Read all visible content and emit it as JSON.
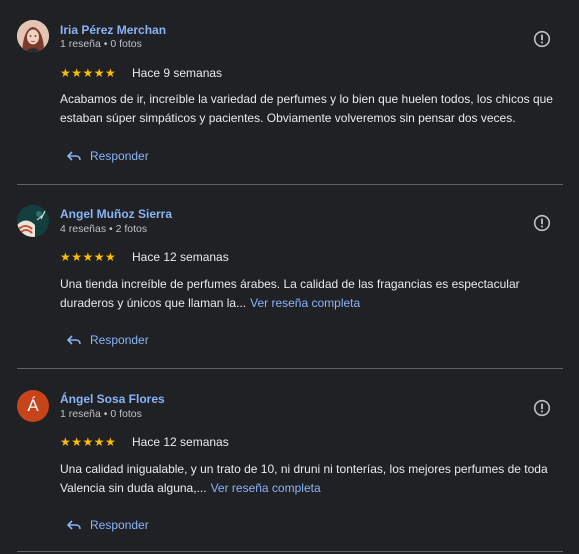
{
  "reviews": [
    {
      "author": "Iria Pérez Merchan",
      "meta": "1 reseña • 0 fotos",
      "avatar_icon": "profile-photo",
      "stars": "★★★★★",
      "date": "Hace 9 semanas",
      "text": "Acabamos de ir, increíble la variedad de perfumes y lo bien que huelen todos, los chicos que estaban súper simpáticos y pacientes. Obviamente volveremos sin pensar dos veces.",
      "more_link": "",
      "reply_label": "Responder"
    },
    {
      "author": "Angel Muñoz Sierra",
      "meta": "4 reseñas • 2 fotos",
      "avatar_icon": "profile-photo",
      "stars": "★★★★★",
      "date": "Hace 12 semanas",
      "text": "Una tienda increíble de perfumes árabes. La calidad de las fragancias es espectacular duraderos y únicos que llaman la...",
      "more_link": "Ver reseña completa",
      "reply_label": "Responder"
    },
    {
      "author": "Ángel Sosa Flores",
      "meta": "1 reseña • 0 fotos",
      "avatar_letter": "Á",
      "avatar_color": "#c5441a",
      "stars": "★★★★★",
      "date": "Hace 12 semanas",
      "text": "Una calidad inigualable, y un trato de 10, ni druni ni tonterías, los mejores perfumes de toda Valencia sin duda alguna,...",
      "more_link": "Ver reseña completa",
      "reply_label": "Responder"
    }
  ],
  "colors": {
    "background": "#202124",
    "link": "#8ab4f8",
    "star": "#fbbc04"
  }
}
